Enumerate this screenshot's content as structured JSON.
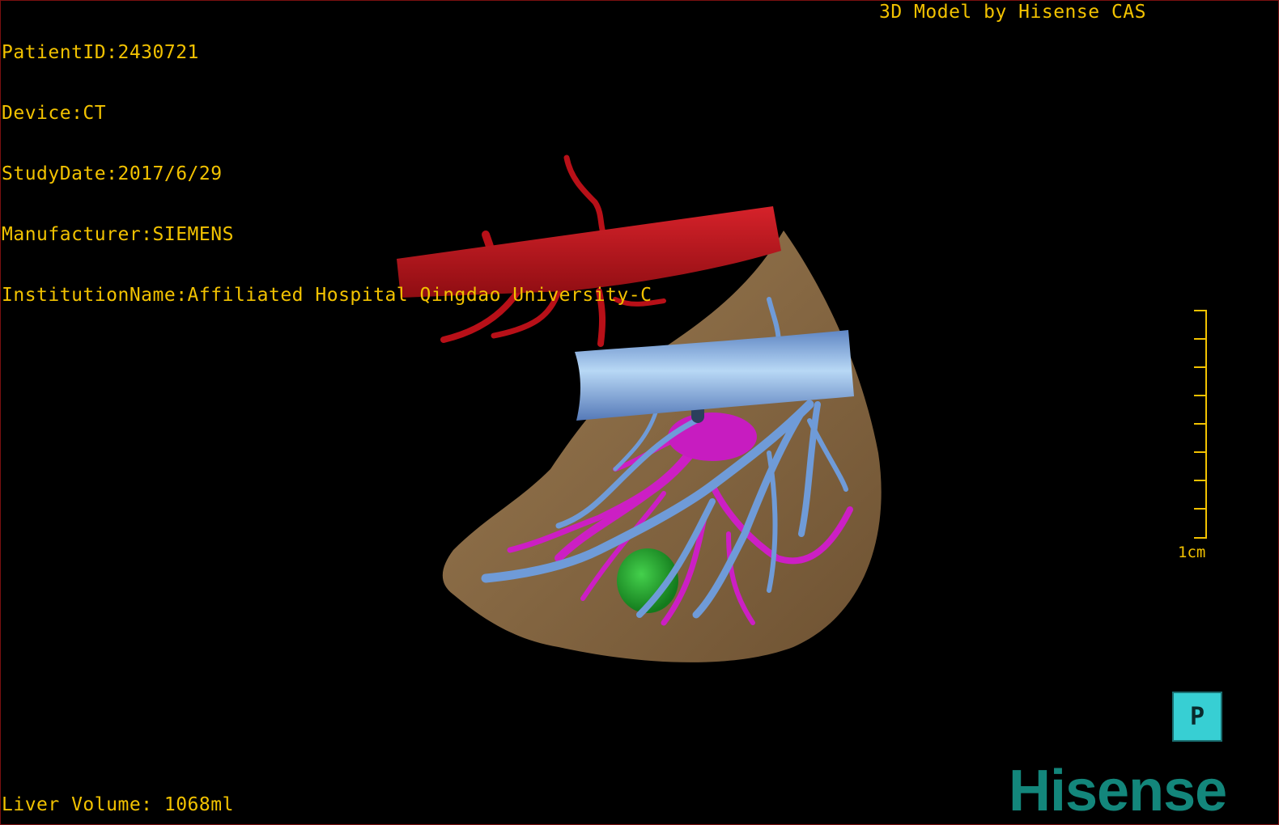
{
  "meta": {
    "patient_id": "PatientID:2430721",
    "device": "Device:CT",
    "study_date": "StudyDate:2017/6/29",
    "manufacturer": "Manufacturer:SIEMENS",
    "institution": "InstitutionName:Affiliated Hospital Qingdao University-C"
  },
  "caption": "3D Model by Hisense CAS",
  "liver_volume": "Liver Volume: 1068ml",
  "scale": {
    "label": "1cm"
  },
  "orientation_button": {
    "label": "P"
  },
  "logo": "Hisense",
  "colors": {
    "overlay_text": "#f2c200",
    "artery": "#c0141c",
    "portal_vein": "#7aa4e0",
    "hepatic_vein": "#d020c8",
    "liver": "#8a6a44",
    "tumor": "#20a030",
    "brand": "#13867b"
  }
}
